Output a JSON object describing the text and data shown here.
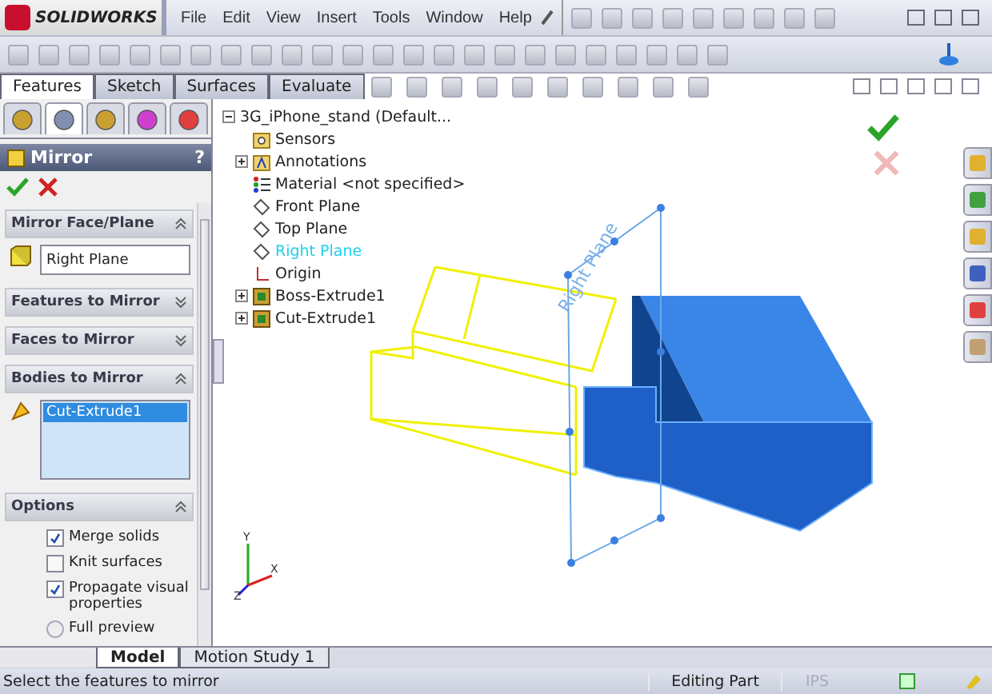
{
  "app": {
    "logo": "SOLIDWORKS",
    "menu": [
      "File",
      "Edit",
      "View",
      "Insert",
      "Tools",
      "Window",
      "Help"
    ]
  },
  "command_tabs": [
    {
      "label": "Features",
      "selected": true
    },
    {
      "label": "Sketch",
      "selected": false
    },
    {
      "label": "Surfaces",
      "selected": false
    },
    {
      "label": "Evaluate",
      "selected": false
    }
  ],
  "panel_tabs": [
    {
      "kind": "features",
      "selected": false
    },
    {
      "kind": "properties",
      "selected": true
    },
    {
      "kind": "configurations",
      "selected": false
    },
    {
      "kind": "target",
      "selected": false
    },
    {
      "kind": "display",
      "selected": false
    }
  ],
  "property_manager": {
    "title": "Mirror",
    "help": "?",
    "sections": [
      {
        "title": "Mirror Face/Plane",
        "expanded": true,
        "field": {
          "value": "Right Plane"
        }
      },
      {
        "title": "Features to Mirror",
        "expanded": false
      },
      {
        "title": "Faces to Mirror",
        "expanded": false
      },
      {
        "title": "Bodies to Mirror",
        "expanded": true,
        "list": [
          {
            "label": "Cut-Extrude1",
            "selected": true
          }
        ]
      },
      {
        "title": "Options",
        "expanded": true,
        "options": [
          {
            "kind": "checkbox",
            "label": "Merge solids",
            "checked": true
          },
          {
            "kind": "checkbox",
            "label": "Knit surfaces",
            "checked": false
          },
          {
            "kind": "checkbox",
            "label": "Propagate visual properties",
            "checked": true
          },
          {
            "kind": "radio",
            "label": "Full preview",
            "selected": false
          }
        ]
      }
    ]
  },
  "tree": {
    "label": "3G_iPhone_stand  (Default...",
    "expanded": true,
    "children": [
      {
        "kind": "sensors",
        "label": "Sensors",
        "selected": false
      },
      {
        "kind": "annotations",
        "label": "Annotations",
        "expanded": false,
        "selected": false
      },
      {
        "kind": "material",
        "label": "Material <not specified>",
        "selected": false
      },
      {
        "kind": "plane",
        "label": "Front Plane",
        "selected": false
      },
      {
        "kind": "plane",
        "label": "Top Plane",
        "selected": false
      },
      {
        "kind": "plane",
        "label": "Right Plane",
        "selected": true
      },
      {
        "kind": "origin",
        "label": "Origin",
        "selected": false
      },
      {
        "kind": "feature",
        "label": "Boss-Extrude1",
        "expanded": false,
        "selected": false
      },
      {
        "kind": "feature",
        "label": "Cut-Extrude1",
        "expanded": false,
        "selected": false
      }
    ]
  },
  "viewport": {
    "plane_label": "Right Plane",
    "triad": [
      "Y",
      "X",
      "Z"
    ]
  },
  "bottom_tabs": [
    {
      "label": "Model",
      "selected": true
    },
    {
      "label": "Motion Study 1",
      "selected": false
    }
  ],
  "status_bar": {
    "message": "Select the features to mirror",
    "mode": "Editing Part",
    "units": "IPS"
  }
}
